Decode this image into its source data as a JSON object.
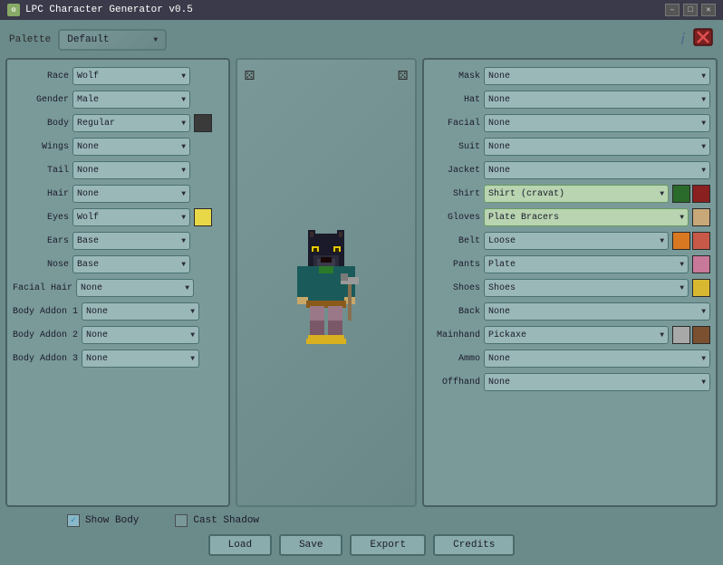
{
  "window": {
    "title": "LPC Character Generator v0.5",
    "min_btn": "–",
    "max_btn": "□",
    "close_btn": "✕"
  },
  "top": {
    "palette_label": "Palette",
    "palette_value": "Default"
  },
  "left_panel": {
    "rows": [
      {
        "label": "Race",
        "value": "Wolf",
        "swatch": null
      },
      {
        "label": "Gender",
        "value": "Male",
        "swatch": null
      },
      {
        "label": "Body",
        "value": "Regular",
        "swatch": "#3a3a3a"
      },
      {
        "label": "Wings",
        "value": "None",
        "swatch": null
      },
      {
        "label": "Tail",
        "value": "None",
        "swatch": null
      },
      {
        "label": "Hair",
        "value": "None",
        "swatch": null
      },
      {
        "label": "Eyes",
        "value": "Wolf",
        "swatch": "#e8d848"
      },
      {
        "label": "Ears",
        "value": "Base",
        "swatch": null
      },
      {
        "label": "Nose",
        "value": "Base",
        "swatch": null
      },
      {
        "label": "Facial Hair",
        "value": "None",
        "swatch": null
      },
      {
        "label": "Body Addon 1",
        "value": "None",
        "swatch": null
      },
      {
        "label": "Body Addon 2",
        "value": "None",
        "swatch": null
      },
      {
        "label": "Body Addon 3",
        "value": "None",
        "swatch": null
      }
    ]
  },
  "right_panel": {
    "rows": [
      {
        "label": "Mask",
        "value": "None",
        "active": false,
        "swatches": []
      },
      {
        "label": "Hat",
        "value": "None",
        "active": false,
        "swatches": []
      },
      {
        "label": "Facial",
        "value": "None",
        "active": false,
        "swatches": []
      },
      {
        "label": "Suit",
        "value": "None",
        "active": false,
        "swatches": []
      },
      {
        "label": "Jacket",
        "value": "None",
        "active": false,
        "swatches": []
      },
      {
        "label": "Shirt",
        "value": "Shirt (cravat)",
        "active": true,
        "swatches": [
          "#2a6a2a",
          "#8a2020"
        ]
      },
      {
        "label": "Gloves",
        "value": "Plate Bracers",
        "active": true,
        "swatches": [
          "#c8a878"
        ]
      },
      {
        "label": "Belt",
        "value": "Loose",
        "active": false,
        "swatches": [
          "#d87820",
          "#c85848"
        ]
      },
      {
        "label": "Pants",
        "value": "Plate",
        "active": false,
        "swatches": [
          "#c87898"
        ]
      },
      {
        "label": "Shoes",
        "value": "Shoes",
        "active": false,
        "swatches": [
          "#d8b830"
        ]
      },
      {
        "label": "Back",
        "value": "None",
        "active": false,
        "swatches": []
      },
      {
        "label": "Mainhand",
        "value": "Pickaxe",
        "active": false,
        "swatches": [
          "#a8a8a8",
          "#7a5030"
        ]
      },
      {
        "label": "Ammo",
        "value": "None",
        "active": false,
        "swatches": []
      },
      {
        "label": "Offhand",
        "value": "None",
        "active": false,
        "swatches": []
      }
    ]
  },
  "checkboxes": {
    "show_body": {
      "label": "Show Body",
      "checked": true
    },
    "cast_shadow": {
      "label": "Cast Shadow",
      "checked": false
    }
  },
  "buttons": {
    "load": "Load",
    "save": "Save",
    "export": "Export",
    "credits": "Credits"
  }
}
